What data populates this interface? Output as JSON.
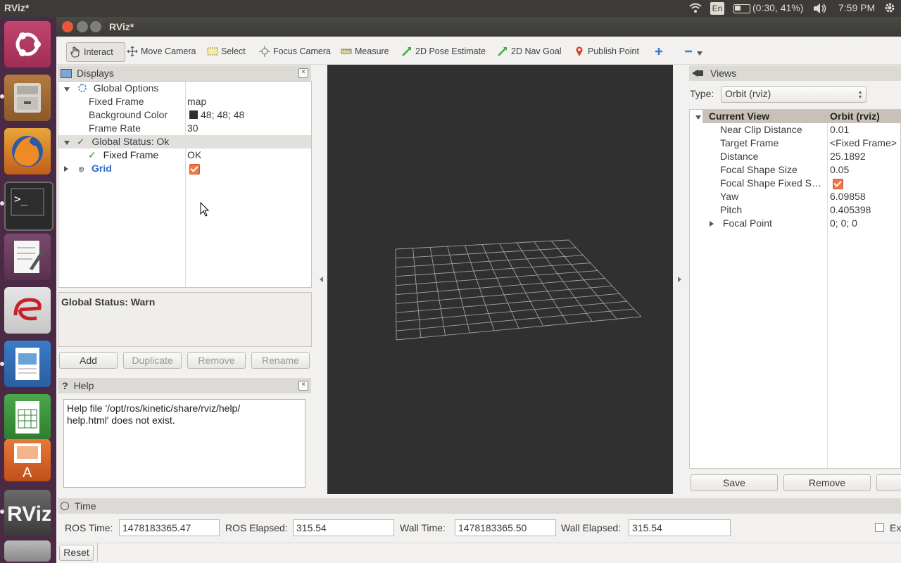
{
  "system": {
    "app_name": "RViz*",
    "lang": "En",
    "battery": "(0:30, 41%)",
    "time": "7:59 PM"
  },
  "window": {
    "title": "RViz*"
  },
  "toolbar": {
    "tools": [
      {
        "label": "Interact",
        "icon": "hand-icon"
      },
      {
        "label": "Move Camera",
        "icon": "move-icon"
      },
      {
        "label": "Select",
        "icon": "select-icon"
      },
      {
        "label": "Focus Camera",
        "icon": "focus-icon"
      },
      {
        "label": "Measure",
        "icon": "ruler-icon"
      },
      {
        "label": "2D Pose Estimate",
        "icon": "green-arrow-icon"
      },
      {
        "label": "2D Nav Goal",
        "icon": "green-arrow-icon"
      },
      {
        "label": "Publish Point",
        "icon": "map-pin-icon"
      }
    ]
  },
  "displays": {
    "title": "Displays",
    "global_options": "Global Options",
    "props": [
      {
        "name": "Fixed Frame",
        "value": "map"
      },
      {
        "name": "Background Color",
        "value": "48; 48; 48"
      },
      {
        "name": "Frame Rate",
        "value": "30"
      }
    ],
    "global_status": "Global Status: Ok",
    "status_fixed_frame": {
      "name": "Fixed Frame",
      "value": "OK"
    },
    "grid": "Grid",
    "status_text": "Global Status: Warn",
    "buttons": {
      "add": "Add",
      "duplicate": "Duplicate",
      "remove": "Remove",
      "rename": "Rename"
    }
  },
  "help": {
    "title": "Help",
    "line1": "Help file '/opt/ros/kinetic/share/rviz/help/",
    "line2": "help.html' does not exist."
  },
  "views": {
    "title": "Views",
    "type_label": "Type:",
    "type_value": "Orbit (rviz)",
    "header_name": "Current View",
    "header_value": "Orbit (rviz)",
    "props": [
      {
        "name": "Near Clip Distance",
        "value": "0.01"
      },
      {
        "name": "Target Frame",
        "value": "<Fixed Frame>"
      },
      {
        "name": "Distance",
        "value": "25.1892"
      },
      {
        "name": "Focal Shape Size",
        "value": "0.05"
      },
      {
        "name": "Focal Shape Fixed S…",
        "value": ""
      },
      {
        "name": "Yaw",
        "value": "6.09858"
      },
      {
        "name": "Pitch",
        "value": "0.405398"
      },
      {
        "name": "Focal Point",
        "value": "0; 0; 0"
      }
    ],
    "save": "Save",
    "remove": "Remove"
  },
  "time": {
    "title": "Time",
    "ros_time_label": "ROS Time:",
    "ros_time": "1478183365.47",
    "ros_elapsed_label": "ROS Elapsed:",
    "ros_elapsed": "315.54",
    "wall_time_label": "Wall Time:",
    "wall_time": "1478183365.50",
    "wall_elapsed_label": "Wall Elapsed:",
    "wall_elapsed": "315.54",
    "experimental": "Ex",
    "reset": "Reset"
  },
  "colors": {
    "viewport_bg": "#303030",
    "accent": "#f07746",
    "launcher": "#4a2a45"
  }
}
